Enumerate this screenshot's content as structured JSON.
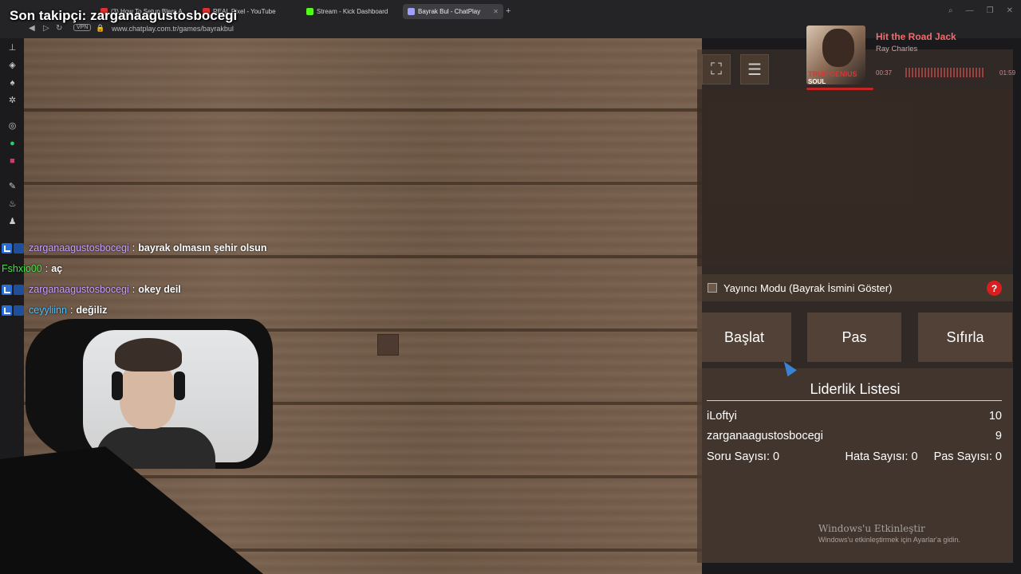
{
  "browser": {
    "tabs": [
      {
        "label": "(3) How To Setup Blerp A",
        "icon_color": "#e03030"
      },
      {
        "label": "REAL Pixel - YouTube",
        "icon_color": "#e03030"
      },
      {
        "label": "Stream - Kick Dashboard",
        "icon_color": "#53fc18"
      },
      {
        "label": "Bayrak Bul - ChatPlay",
        "icon_color": "#a0a0ff"
      }
    ],
    "new_tab_icon": "plus-icon",
    "vpn_label": "VPN",
    "url": "www.chatplay.com.tr/games/bayrakbul"
  },
  "overlay": {
    "follower_text": "Son takipçi: zarganaagustosbocegi"
  },
  "sidebar": {
    "icons": [
      "pin-icon",
      "compass-icon",
      "bell-icon",
      "settings-icon",
      "globe-icon",
      "whatsapp-icon",
      "instagram-icon",
      "tool-icon",
      "flame-icon",
      "bag-icon"
    ]
  },
  "chat": {
    "messages": [
      {
        "user": "zarganaagustosbocegi",
        "text": "bayrak olmasın şehir olsun",
        "color": "#c8a2ff"
      },
      {
        "user": "Fshxio00",
        "text": "aç",
        "color": "#4be04b"
      },
      {
        "user": "zarganaagustosbocegi",
        "text": "okey deil",
        "color": "#c8a2ff"
      },
      {
        "user": "ceyyliinn",
        "text": "değiliz",
        "color": "#4fc3ff"
      }
    ]
  },
  "game": {
    "streamer_mode_label": "Yayıncı Modu (Bayrak İsmini Göster)",
    "help_label": "?",
    "buttons": {
      "start": "Başlat",
      "pass": "Pas",
      "reset": "Sıfırla"
    },
    "leaderboard": {
      "title": "Liderlik Listesi",
      "rows": [
        {
          "name": "iLoftyi",
          "score": "10"
        },
        {
          "name": "zarganaagustosbocegi",
          "score": "9"
        }
      ],
      "stats": {
        "questions": "Soru Sayısı: 0",
        "errors": "Hata Sayısı: 0",
        "passes": "Pas Sayısı: 0"
      }
    }
  },
  "music": {
    "title": "Hit the Road Jack",
    "artist": "Ray Charles",
    "elapsed": "00:37",
    "total": "01:59",
    "album_text_1": "TRUE GENIUS",
    "album_text_2": "SOUL",
    "progress": 0.31
  },
  "watermark": {
    "title": "Windows'u Etkinleştir",
    "subtitle": "Windows'u etkinleştirmek için Ayarlar'a gidin."
  }
}
